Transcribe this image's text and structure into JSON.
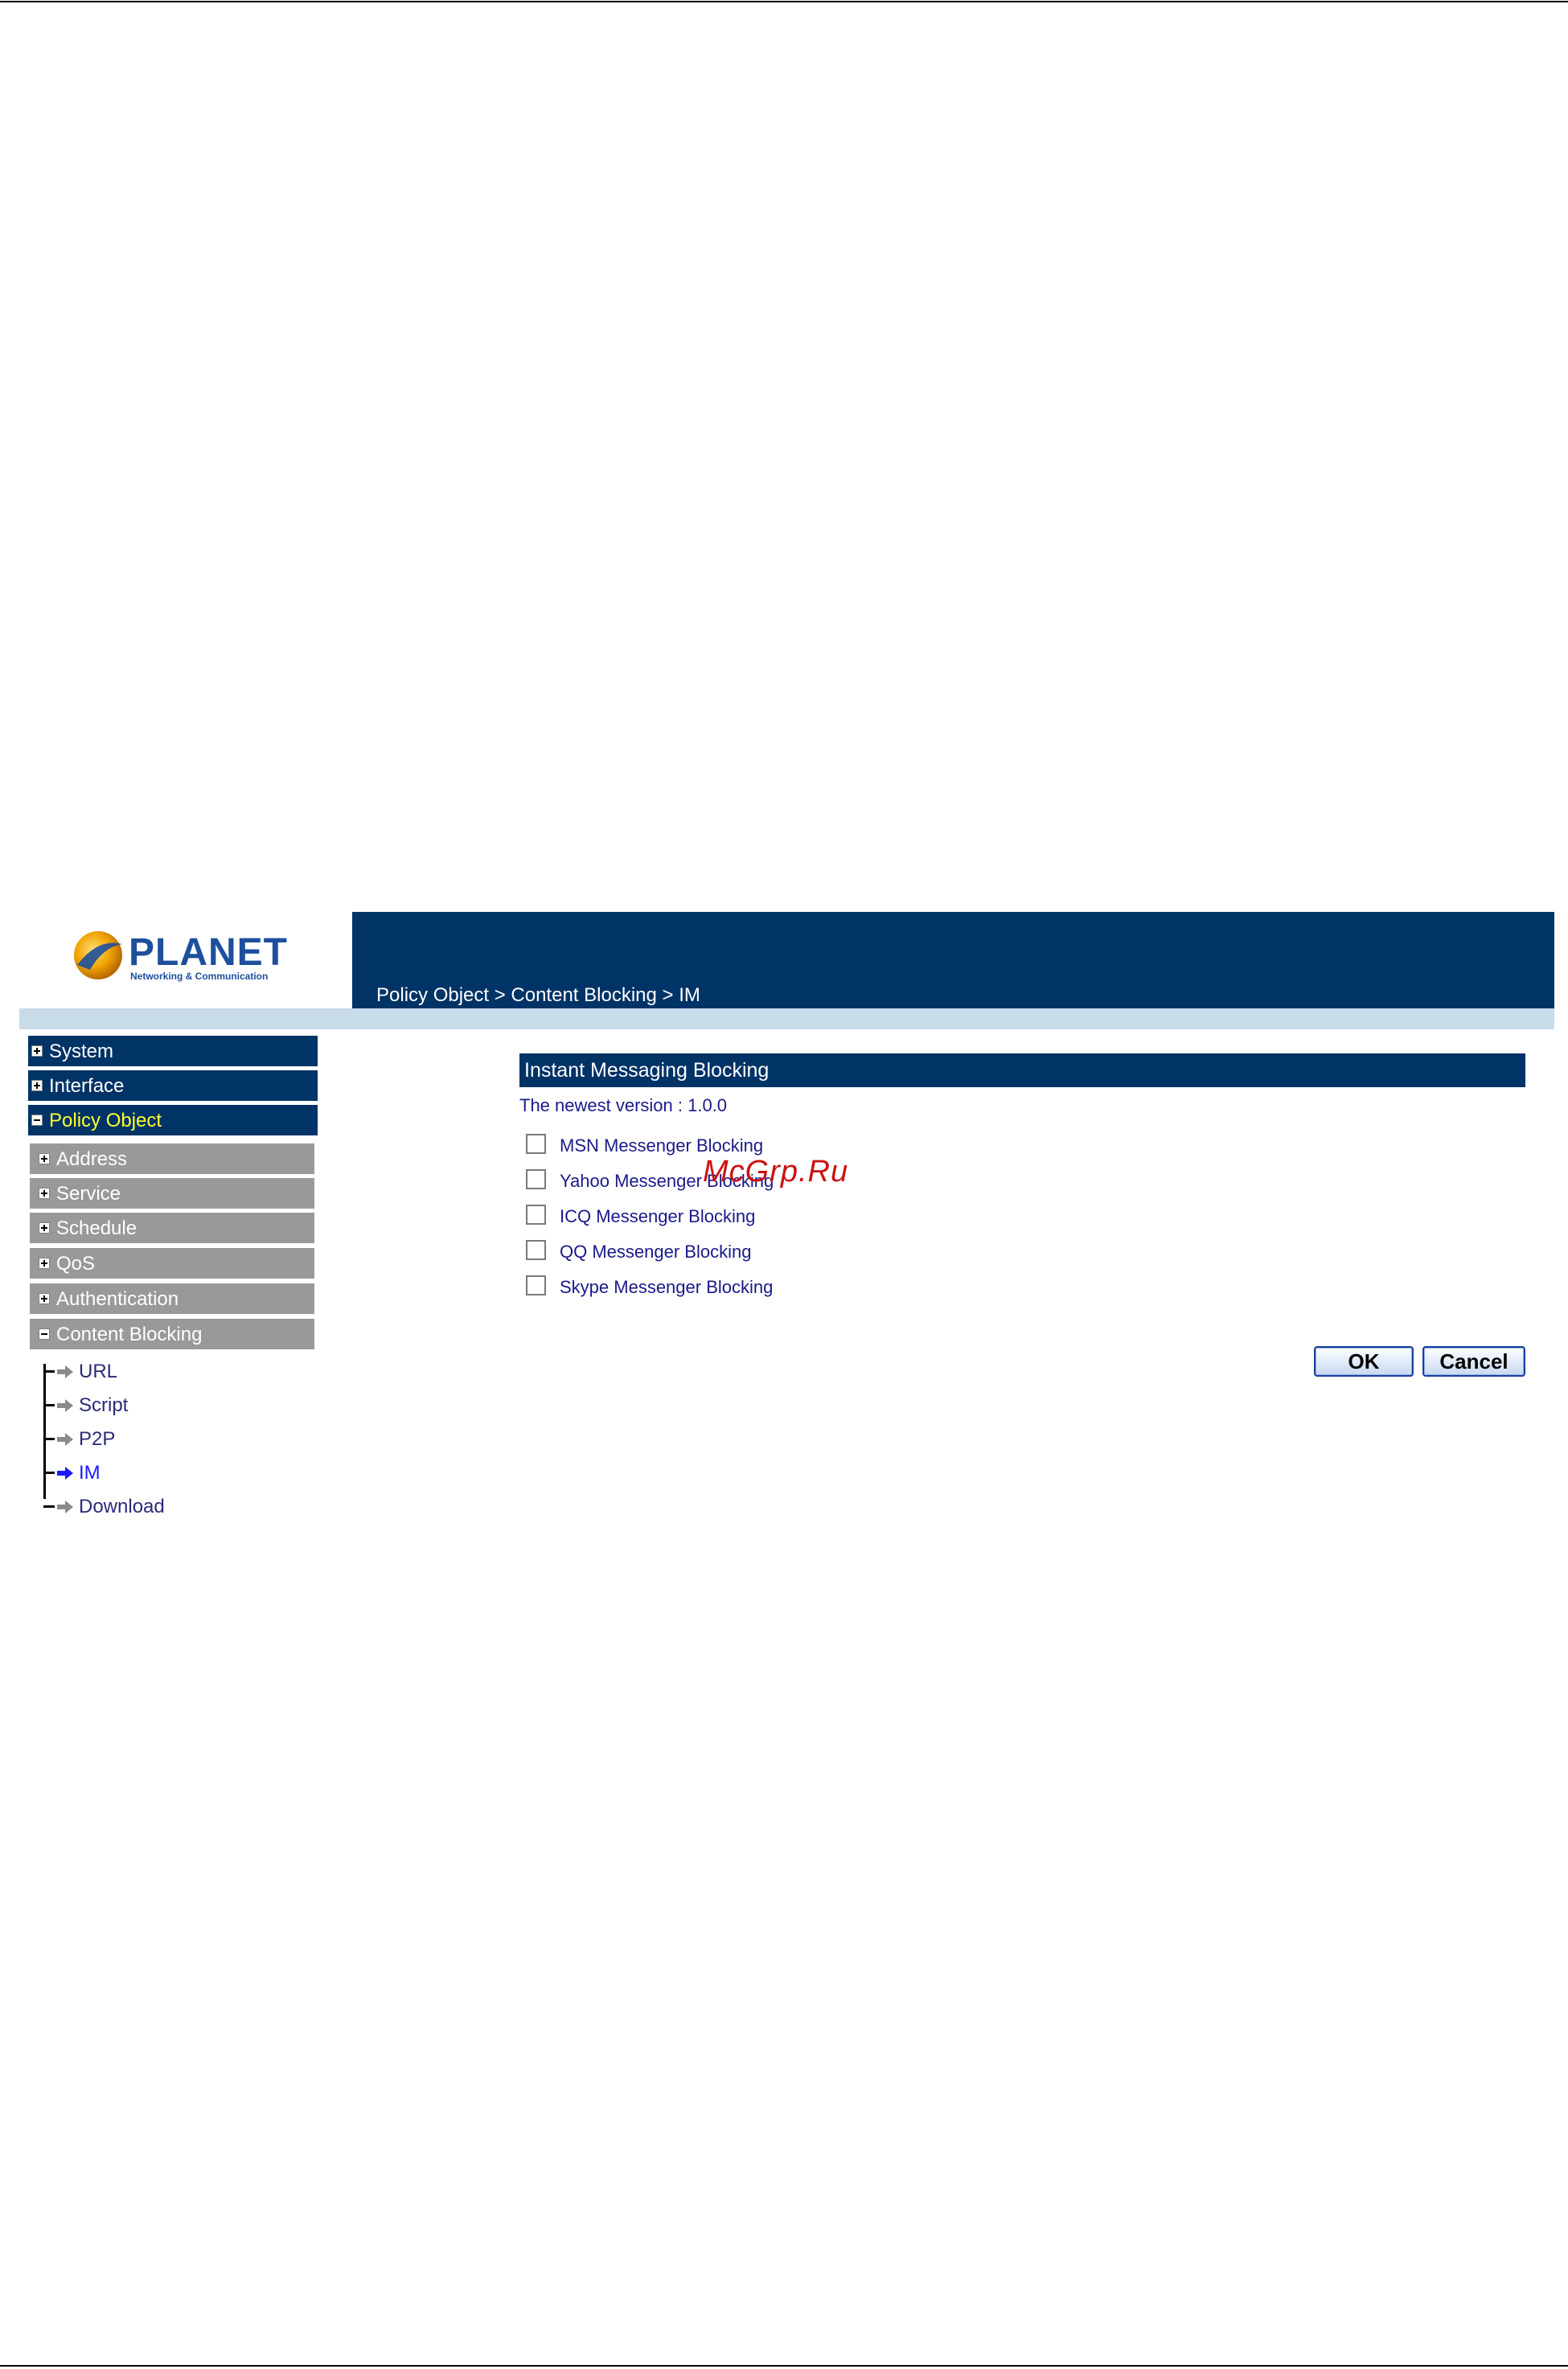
{
  "brand": {
    "name": "PLANET",
    "tagline": "Networking & Communication",
    "colors": {
      "header": "#003366",
      "strip": "#c8dbe9",
      "submenu": "#999999",
      "active": "#ffff33"
    }
  },
  "header": {
    "breadcrumb": "Policy Object > Content Blocking > IM"
  },
  "sidebar": {
    "main_items": [
      {
        "label": "System",
        "icon": "plus-icon"
      },
      {
        "label": "Interface",
        "icon": "plus-icon"
      },
      {
        "label": "Policy Object",
        "icon": "minus-icon",
        "active": true
      }
    ],
    "sub_items": [
      {
        "label": "Address",
        "icon": "plus-icon"
      },
      {
        "label": "Service",
        "icon": "plus-icon"
      },
      {
        "label": "Schedule",
        "icon": "plus-icon"
      },
      {
        "label": "QoS",
        "icon": "plus-icon"
      },
      {
        "label": "Authentication",
        "icon": "plus-icon"
      },
      {
        "label": "Content Blocking",
        "icon": "minus-icon"
      }
    ],
    "tree_items": [
      {
        "label": "URL",
        "icon": "arrow-right-icon"
      },
      {
        "label": "Script",
        "icon": "arrow-right-icon"
      },
      {
        "label": "P2P",
        "icon": "arrow-right-icon"
      },
      {
        "label": "IM",
        "icon": "arrow-right-icon",
        "current": true
      },
      {
        "label": "Download",
        "icon": "arrow-right-icon"
      }
    ]
  },
  "main": {
    "title": "Instant Messaging Blocking",
    "version": "The newest version : 1.0.0",
    "options": [
      {
        "label": "MSN Messenger Blocking",
        "checked": false
      },
      {
        "label": "Yahoo Messenger Blocking",
        "checked": false
      },
      {
        "label": "ICQ Messenger Blocking",
        "checked": false
      },
      {
        "label": "QQ Messenger Blocking",
        "checked": false
      },
      {
        "label": "Skype Messenger Blocking",
        "checked": false
      }
    ],
    "ok_label": "OK",
    "cancel_label": "Cancel"
  },
  "watermark": "McGrp.Ru"
}
